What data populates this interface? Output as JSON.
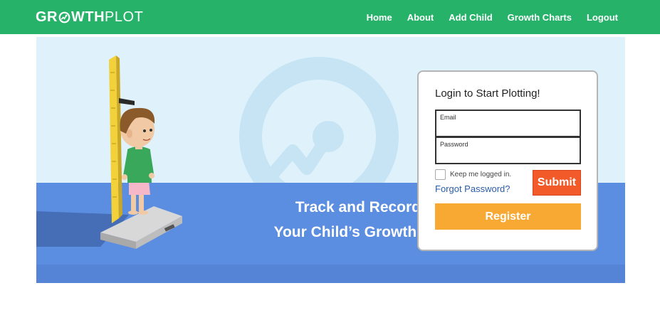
{
  "brand": {
    "bold": "GROWTH",
    "light": "PLOT",
    "icon": "growth-o-icon"
  },
  "nav": {
    "items": [
      {
        "label": "Home"
      },
      {
        "label": "About"
      },
      {
        "label": "Add Child"
      },
      {
        "label": "Growth Charts"
      },
      {
        "label": "Logout"
      }
    ]
  },
  "hero": {
    "line1": "Track and Record",
    "line2": "Your Child’s Growth.",
    "illustration": "child-measuring-height",
    "colors": {
      "sky": "#dff2fb",
      "floor": "#5b8de0",
      "circle": "#c6e4f4",
      "nav": "#27b26a"
    }
  },
  "login": {
    "title": "Login to Start Plotting!",
    "email_label": "Email",
    "email_value": "",
    "password_label": "Password",
    "password_value": "",
    "remember_label": "Keep me logged in.",
    "remember_checked": false,
    "forgot_label": "Forgot Password?",
    "submit_label": "Submit",
    "register_label": "Register",
    "colors": {
      "submit": "#f25a2a",
      "register": "#f8a933",
      "link": "#2a5dab"
    }
  }
}
